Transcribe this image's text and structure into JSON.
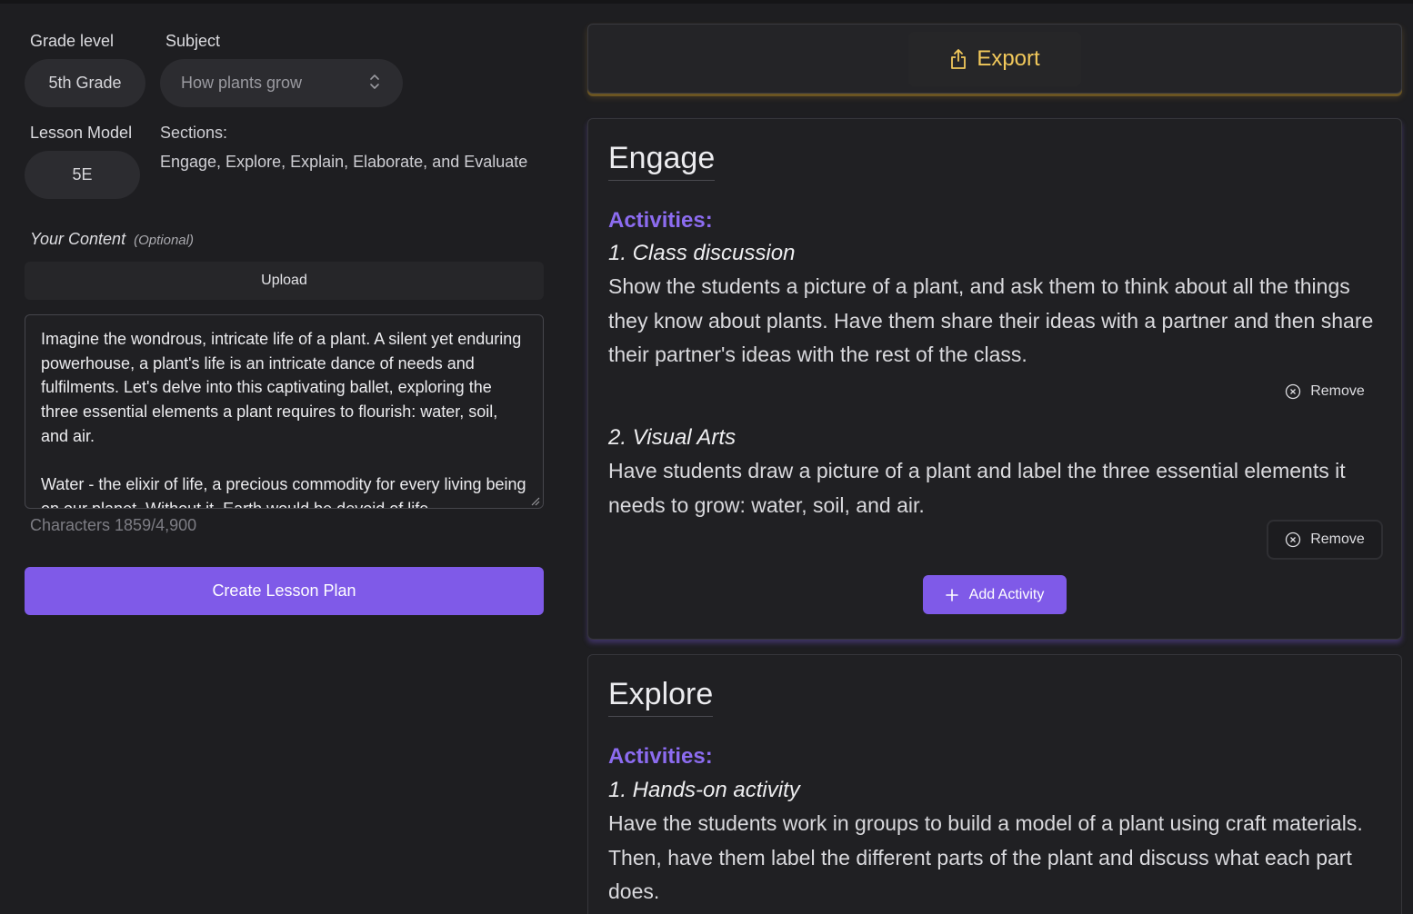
{
  "form": {
    "grade_label": "Grade level",
    "grade_value": "5th Grade",
    "subject_label": "Subject",
    "subject_value": "How plants grow",
    "model_label": "Lesson Model",
    "model_value": "5E",
    "sections_title": "Sections:",
    "sections_text": "Engage, Explore, Explain, Elaborate, and Evaluate",
    "content_label": "Your Content",
    "content_optional": "(Optional)",
    "upload_label": "Upload",
    "content_text": "Imagine the wondrous, intricate life of a plant. A silent yet enduring powerhouse, a plant's life is an intricate dance of needs and fulfilments. Let's delve into this captivating ballet, exploring the three essential elements a plant requires to flourish: water, soil, and air.\n\nWater - the elixir of life, a precious commodity for every living being on our planet. Without it, Earth would be devoid of life",
    "characters": "Characters 1859/4,900",
    "create_label": "Create Lesson Plan"
  },
  "export": {
    "label": "Export"
  },
  "engage": {
    "title": "Engage",
    "activities_label": "Activities:",
    "activities": [
      {
        "title": "1. Class discussion",
        "description": "Show the students a picture of a plant, and ask them to think about all the things they know about plants. Have them share their ideas with a partner and then share their partner's ideas with the rest of the class.",
        "remove_label": "Remove"
      },
      {
        "title": "2. Visual Arts",
        "description": "Have students draw a picture of a plant and label the three essential elements it needs to grow: water, soil, and air.",
        "remove_label": "Remove"
      }
    ],
    "add_label": "Add Activity"
  },
  "explore": {
    "title": "Explore",
    "activities_label": "Activities:",
    "activities": [
      {
        "title": "1. Hands-on activity",
        "description": "Have the students work in groups to build a model of a plant using craft materials. Then, have them label the different parts of the plant and discuss what each part does."
      }
    ]
  },
  "colors": {
    "accent": "#7f5ae8",
    "export": "#f2c95b",
    "background": "#1e1e21"
  }
}
